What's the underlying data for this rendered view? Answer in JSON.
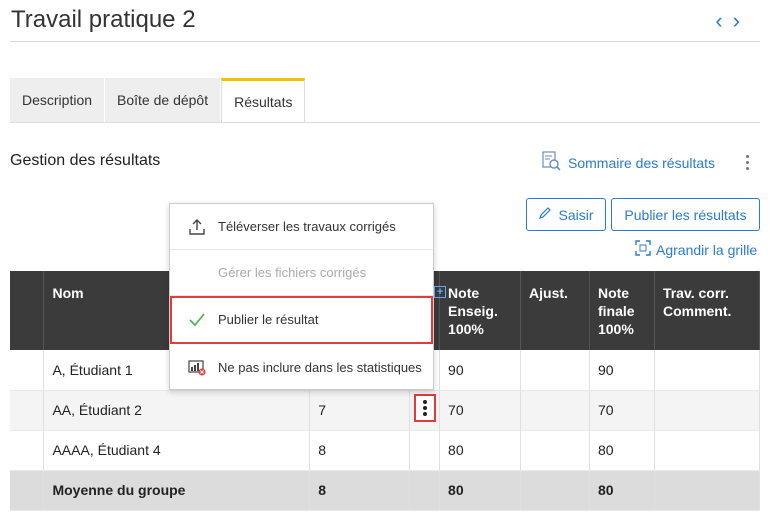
{
  "page": {
    "title": "Travail pratique 2",
    "nav": {
      "prev": "‹",
      "next": "›"
    }
  },
  "tabs": [
    {
      "label": "Description",
      "active": false
    },
    {
      "label": "Boîte de dépôt",
      "active": false
    },
    {
      "label": "Résultats",
      "active": true
    }
  ],
  "section": {
    "title": "Gestion des résultats",
    "summary_link": "Sommaire des résultats"
  },
  "toolbar": {
    "saisir": "Saisir",
    "publier": "Publier les résultats",
    "agrandir": "Agrandir la grille"
  },
  "table": {
    "headers": {
      "nom": "Nom",
      "note_enseig": "Note Enseig. 100%",
      "ajust": "Ajust.",
      "note_finale": "Note finale 100%",
      "trav_corr": "Trav. corr. Comment."
    },
    "rows": [
      {
        "nom": "A, Étudiant 1",
        "score": "",
        "note_enseig": "90",
        "ajust": "",
        "note_finale": "90",
        "trav": ""
      },
      {
        "nom": "AA, Étudiant 2",
        "score": "7",
        "note_enseig": "70",
        "ajust": "",
        "note_finale": "70",
        "trav": ""
      },
      {
        "nom": "AAAA, Étudiant 4",
        "score": "8",
        "note_enseig": "80",
        "ajust": "",
        "note_finale": "80",
        "trav": ""
      }
    ],
    "average": {
      "label": "Moyenne du groupe",
      "score": "8",
      "note_enseig": "80",
      "note_finale": "80"
    }
  },
  "menu": {
    "items": [
      {
        "label": "Téléverser les travaux corrigés",
        "disabled": false
      },
      {
        "label": "Gérer les fichiers corrigés",
        "disabled": true
      },
      {
        "label": "Publier le résultat",
        "disabled": false,
        "highlighted": true
      },
      {
        "label": "Ne pas inclure dans les statistiques",
        "disabled": false
      }
    ]
  },
  "colors": {
    "accent": "#2b7bd0",
    "tab_active": "#f2c200",
    "highlight": "#e03c3c",
    "header_bg": "#3b3b3b"
  }
}
